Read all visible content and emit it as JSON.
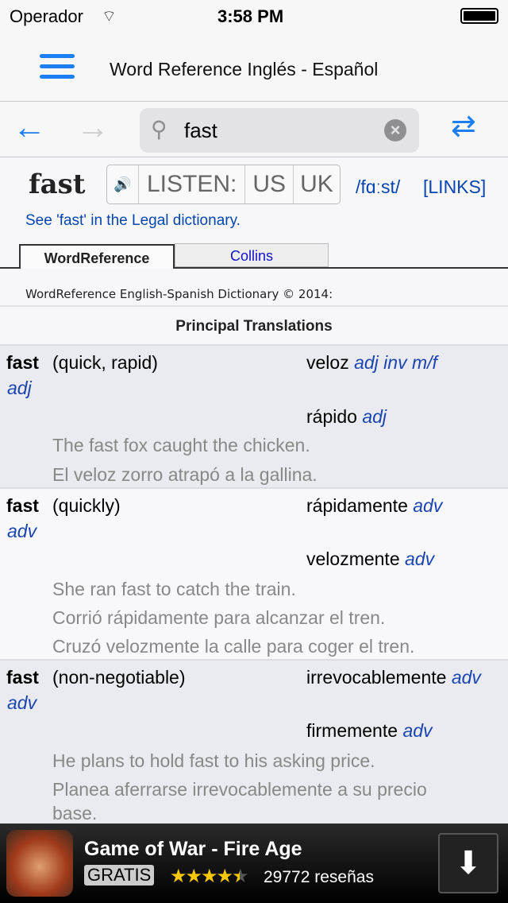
{
  "status": {
    "carrier": "Operador",
    "time": "3:58 PM"
  },
  "nav": {
    "title": "Word Reference Inglés - Español"
  },
  "search": {
    "value": "fast"
  },
  "header": {
    "word": "fast",
    "listen": "LISTEN:",
    "us": "US",
    "uk": "UK",
    "pron": "/fɑːst/",
    "links": "[LINKS]",
    "legal": "See 'fast' in the Legal dictionary."
  },
  "tabs": [
    {
      "label": "WordReference",
      "active": true
    },
    {
      "label": "Collins",
      "active": false
    }
  ],
  "copyright": "WordReference English-Spanish Dictionary © 2014:",
  "section": "Principal Translations",
  "entries": [
    {
      "word": "fast",
      "pos": "adj",
      "sense": "(quick, rapid)",
      "translations": [
        {
          "text": "veloz",
          "pos": "adj inv m/f"
        },
        {
          "text": "rápido",
          "pos": "adj"
        }
      ],
      "examples": [
        "The fast fox caught the chicken.",
        "El veloz zorro atrapó a la gallina."
      ]
    },
    {
      "word": "fast",
      "pos": "adv",
      "sense": "(quickly)",
      "translations": [
        {
          "text": "rápidamente",
          "pos": "adv"
        },
        {
          "text": "velozmente",
          "pos": "adv"
        }
      ],
      "examples": [
        "She ran fast to catch the train.",
        "Corrió rápidamente para alcanzar el tren.",
        "Cruzó velozmente la calle para coger el tren."
      ]
    },
    {
      "word": "fast",
      "pos": "adv",
      "sense": "(non-negotiable)",
      "translations": [
        {
          "text": "irrevocablemente",
          "pos": "adv"
        },
        {
          "text": "firmemente",
          "pos": "adv"
        }
      ],
      "examples": [
        "He plans to hold fast to his asking price.",
        "Planea aferrarse irrevocablemente a su precio",
        "base."
      ]
    }
  ],
  "ad": {
    "title": "Game of War - Fire Age",
    "price": "GRATIS",
    "rating": 4.5,
    "reviews": "29772 reseñas"
  },
  "colors": {
    "accent": "#1a7ef5",
    "link": "#0645ad"
  }
}
